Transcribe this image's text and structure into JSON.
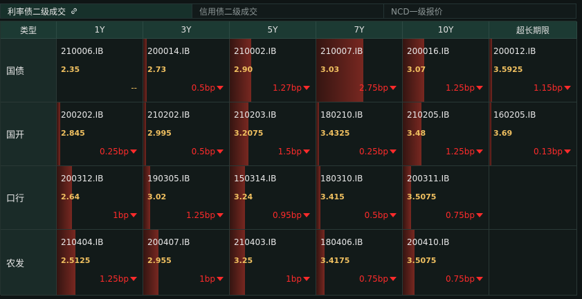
{
  "tabs": [
    {
      "label": "利率债二级成交",
      "active": true,
      "icon": "link-icon"
    },
    {
      "label": "信用债二级成交",
      "active": false
    },
    {
      "label": "NCD一级报价",
      "active": false
    }
  ],
  "headers": [
    "类型",
    "1Y",
    "3Y",
    "5Y",
    "7Y",
    "10Y",
    "超长期限"
  ],
  "rows": [
    {
      "label": "国债",
      "cells": [
        {
          "code": "210006.IB",
          "yield": "2.35",
          "change": "--",
          "bar": 0.0
        },
        {
          "code": "200014.IB",
          "yield": "2.73",
          "change": "0.5bp",
          "bar": 0.04
        },
        {
          "code": "210002.IB",
          "yield": "2.90",
          "change": "1.27bp",
          "bar": 0.25
        },
        {
          "code": "210007.IB",
          "yield": "3.03",
          "change": "2.75bp",
          "bar": 0.55
        },
        {
          "code": "200016.IB",
          "yield": "3.07",
          "change": "1.25bp",
          "bar": 0.25
        },
        {
          "code": "200012.IB",
          "yield": "3.5925",
          "change": "1.15bp",
          "bar": 0.03
        }
      ]
    },
    {
      "label": "国开",
      "cells": [
        {
          "code": "200202.IB",
          "yield": "2.845",
          "change": "0.25bp",
          "bar": 0.04
        },
        {
          "code": "210202.IB",
          "yield": "2.995",
          "change": "0.5bp",
          "bar": 0.03
        },
        {
          "code": "210203.IB",
          "yield": "3.2075",
          "change": "1.5bp",
          "bar": 0.22
        },
        {
          "code": "180210.IB",
          "yield": "3.4325",
          "change": "0.25bp",
          "bar": 0.03
        },
        {
          "code": "210205.IB",
          "yield": "3.48",
          "change": "1.25bp",
          "bar": 0.22
        },
        {
          "code": "160205.IB",
          "yield": "3.69",
          "change": "0.13bp",
          "bar": 0.02
        }
      ]
    },
    {
      "label": "口行",
      "cells": [
        {
          "code": "200312.IB",
          "yield": "2.64",
          "change": "1bp",
          "bar": 0.18
        },
        {
          "code": "190305.IB",
          "yield": "3.02",
          "change": "1.25bp",
          "bar": 0.08
        },
        {
          "code": "150314.IB",
          "yield": "3.24",
          "change": "0.95bp",
          "bar": 0.18
        },
        {
          "code": "180310.IB",
          "yield": "3.415",
          "change": "0.5bp",
          "bar": 0.05
        },
        {
          "code": "200311.IB",
          "yield": "3.5075",
          "change": "0.75bp",
          "bar": 0.1
        },
        null
      ]
    },
    {
      "label": "农发",
      "cells": [
        {
          "code": "210404.IB",
          "yield": "2.5125",
          "change": "1.25bp",
          "bar": 0.22
        },
        {
          "code": "200407.IB",
          "yield": "2.955",
          "change": "1bp",
          "bar": 0.18
        },
        {
          "code": "210403.IB",
          "yield": "3.25",
          "change": "1bp",
          "bar": 0.18
        },
        {
          "code": "180406.IB",
          "yield": "3.4175",
          "change": "0.75bp",
          "bar": 0.1
        },
        {
          "code": "200410.IB",
          "yield": "3.5075",
          "change": "0.75bp",
          "bar": 0.14
        },
        null
      ]
    }
  ],
  "colors": {
    "up": "#ff2b2b",
    "yield": "#f0c060",
    "header_bg": "#1c3a33"
  }
}
